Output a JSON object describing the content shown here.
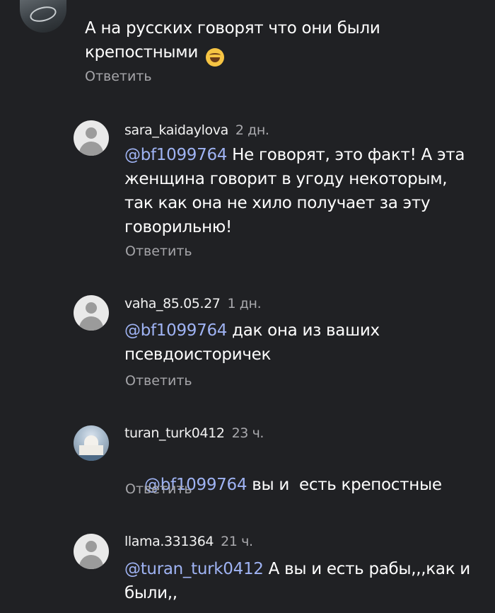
{
  "comments": [
    {
      "username": "",
      "time": "",
      "mention": "",
      "text": "А на русских говорят что они были крепостными",
      "emoji": "😂",
      "reply": "Ответить",
      "avatar": "car-photo-avatar"
    },
    {
      "username": "sara_kaidaylova",
      "time": "2 дн.",
      "mention": "@bf1099764",
      "text": " Не говорят, это факт! А эта женщина говорит в угоду некоторым, так как она не хило получает за эту говорильню!",
      "reply": "Ответить",
      "avatar": "default-user-avatar"
    },
    {
      "username": "vaha_85.05.27",
      "time": "1 дн.",
      "mention": "@bf1099764",
      "text": " дак она из ваших псевдоисторичек",
      "reply": "Ответить",
      "avatar": "default-user-avatar"
    },
    {
      "username": "turan_turk0412",
      "time": "23 ч.",
      "mention": "@bf1099764",
      "text": " вы и  есть крепостные",
      "reply": "Ответить",
      "avatar": "taj-mahal-photo-avatar"
    },
    {
      "username": "llama.331364",
      "time": "21 ч.",
      "mention": "@turan_turk0412",
      "text": " А вы и есть рабы,,,как и были,,",
      "reply": "",
      "avatar": "default-user-avatar"
    }
  ]
}
